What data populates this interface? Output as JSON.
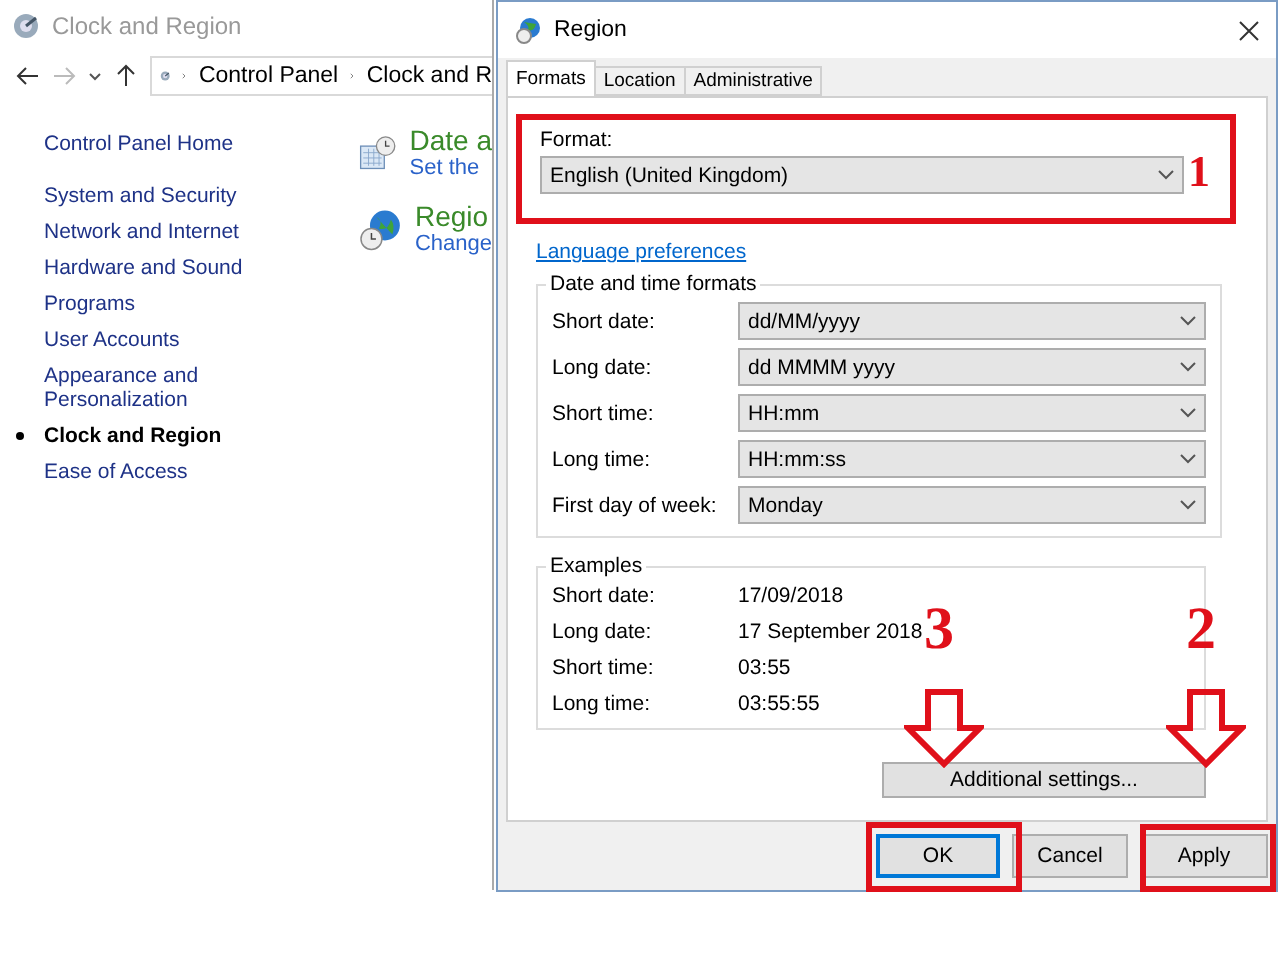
{
  "background_window": {
    "title": "Clock and Region",
    "breadcrumb": [
      "Control Panel",
      "Clock and R"
    ],
    "sidebar": {
      "home": "Control Panel Home",
      "items": [
        {
          "label": "System and Security",
          "selected": false
        },
        {
          "label": "Network and Internet",
          "selected": false
        },
        {
          "label": "Hardware and Sound",
          "selected": false
        },
        {
          "label": "Programs",
          "selected": false
        },
        {
          "label": "User Accounts",
          "selected": false
        },
        {
          "label": "Appearance and Personalization",
          "selected": false
        },
        {
          "label": "Clock and Region",
          "selected": true
        },
        {
          "label": "Ease of Access",
          "selected": false
        }
      ]
    },
    "categories": [
      {
        "kind": "calendar",
        "title": "Date a",
        "link": "Set the"
      },
      {
        "kind": "globe",
        "title": "Regio",
        "link": "Change"
      }
    ]
  },
  "dialog": {
    "title": "Region",
    "tabs": [
      {
        "label": "Formats",
        "selected": true
      },
      {
        "label": "Location",
        "selected": false
      },
      {
        "label": "Administrative",
        "selected": false
      }
    ],
    "format": {
      "label": "Format:",
      "value": "English (United Kingdom)"
    },
    "language_link": "Language preferences",
    "date_time_formats": {
      "title": "Date and time formats",
      "rows": [
        {
          "label": "Short date:",
          "value": "dd/MM/yyyy"
        },
        {
          "label": "Long date:",
          "value": "dd MMMM yyyy"
        },
        {
          "label": "Short time:",
          "value": "HH:mm"
        },
        {
          "label": "Long time:",
          "value": "HH:mm:ss"
        },
        {
          "label": "First day of week:",
          "value": "Monday"
        }
      ]
    },
    "examples": {
      "title": "Examples",
      "rows": [
        {
          "label": "Short date:",
          "value": "17/09/2018"
        },
        {
          "label": "Long date:",
          "value": "17 September 2018"
        },
        {
          "label": "Short time:",
          "value": "03:55"
        },
        {
          "label": "Long time:",
          "value": "03:55:55"
        }
      ]
    },
    "additional_button": "Additional settings...",
    "buttons": [
      {
        "label": "OK",
        "default": true
      },
      {
        "label": "Cancel",
        "default": false
      },
      {
        "label": "Apply",
        "default": false
      }
    ]
  },
  "annotations": [
    {
      "label": "1"
    },
    {
      "label": "3"
    },
    {
      "label": "2"
    }
  ]
}
